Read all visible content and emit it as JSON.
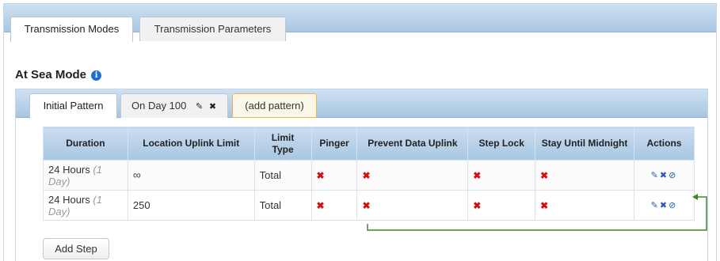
{
  "tabs": [
    {
      "label": "Transmission Modes",
      "active": true
    },
    {
      "label": "Transmission Parameters",
      "active": false
    }
  ],
  "section": {
    "title": "At Sea Mode",
    "info_icon": "info-icon"
  },
  "pattern_tabs": {
    "initial": "Initial Pattern",
    "day100": "On Day 100",
    "add": "(add pattern)"
  },
  "table": {
    "headers": [
      "Duration",
      "Location Uplink Limit",
      "Limit Type",
      "Pinger",
      "Prevent Data Uplink",
      "Step Lock",
      "Stay Until Midnight",
      "Actions"
    ],
    "rows": [
      {
        "duration": "24 Hours",
        "duration_note": "(1 Day)",
        "uplink_limit": "∞",
        "limit_type": "Total"
      },
      {
        "duration": "24 Hours",
        "duration_note": "(1 Day)",
        "uplink_limit": "250",
        "limit_type": "Total"
      }
    ],
    "cross_glyph": "✖",
    "action_icons": [
      "edit-icon",
      "delete-icon",
      "link-icon"
    ]
  },
  "buttons": {
    "add_step": "Add Step"
  },
  "colors": {
    "tab_bar": "#b9d2ea",
    "header_bg": "#b7d0e8",
    "cross": "#d40f0f",
    "annotation_arrow": "#3b8a1e",
    "add_pattern_border": "#f0b24a"
  }
}
